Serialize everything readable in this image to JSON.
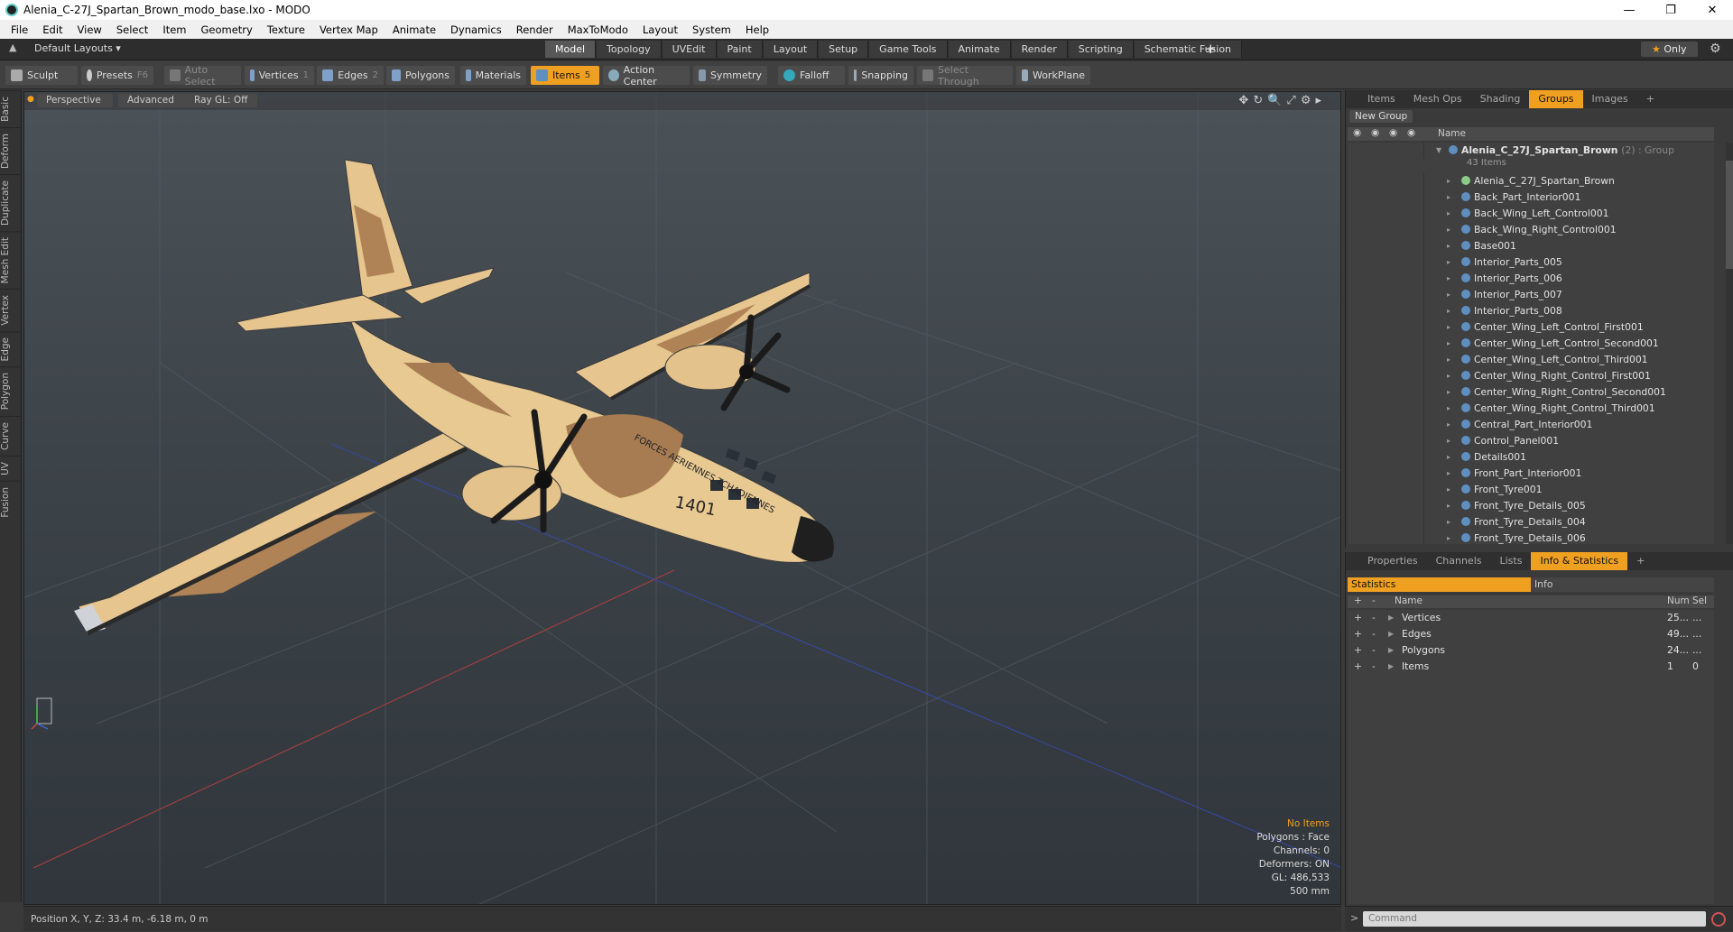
{
  "window": {
    "title": "Alenia_C-27J_Spartan_Brown_modo_base.lxo - MODO"
  },
  "menu": [
    "File",
    "Edit",
    "View",
    "Select",
    "Item",
    "Geometry",
    "Texture",
    "Vertex Map",
    "Animate",
    "Dynamics",
    "Render",
    "MaxToModo",
    "Layout",
    "System",
    "Help"
  ],
  "layouts_label": "Default Layouts ▾",
  "tabs": [
    {
      "label": "Model",
      "active": true
    },
    {
      "label": "Topology"
    },
    {
      "label": "UVEdit"
    },
    {
      "label": "Paint"
    },
    {
      "label": "Layout"
    },
    {
      "label": "Setup"
    },
    {
      "label": "Game Tools"
    },
    {
      "label": "Animate"
    },
    {
      "label": "Render"
    },
    {
      "label": "Scripting"
    },
    {
      "label": "Schematic Fusion"
    }
  ],
  "only_label": "Only",
  "toolbar": {
    "sculpt": "Sculpt",
    "presets": "Presets",
    "presets_key": "F6",
    "auto_select": "Auto Select",
    "vertices": "Vertices",
    "vertices_key": "1",
    "edges": "Edges",
    "edges_key": "2",
    "polygons": "Polygons",
    "materials": "Materials",
    "items": "Items",
    "items_key": "5",
    "action_center": "Action Center",
    "symmetry": "Symmetry",
    "falloff": "Falloff",
    "snapping": "Snapping",
    "select_through": "Select Through",
    "workplane": "WorkPlane"
  },
  "left_tabs": [
    "Basic",
    "Deform",
    "Duplicate",
    "Mesh Edit",
    "Vertex",
    "Edge",
    "Polygon",
    "Curve",
    "UV",
    "Fusion"
  ],
  "viewport": {
    "view": "Perspective",
    "mode": "Advanced",
    "raygl": "Ray GL: Off",
    "hud": {
      "no_items": "No Items",
      "polygons": "Polygons : Face",
      "channels": "Channels: 0",
      "deformers": "Deformers: ON",
      "gl": "GL: 486,533",
      "scale": "500 mm"
    }
  },
  "status": {
    "position": "Position X, Y, Z:  33.4 m, -6.18 m, 0 m"
  },
  "panel_tabs": [
    {
      "label": "Items"
    },
    {
      "label": "Mesh Ops"
    },
    {
      "label": "Shading"
    },
    {
      "label": "Groups",
      "active": true
    },
    {
      "label": "Images"
    }
  ],
  "new_group": "New Group",
  "list_header": "Name",
  "group": {
    "name": "Alenia_C_27J_Spartan_Brown",
    "suffix": "(2) : Group",
    "count": "43 Items"
  },
  "items": [
    "Alenia_C_27J_Spartan_Brown",
    "Back_Part_Interior001",
    "Back_Wing_Left_Control001",
    "Back_Wing_Right_Control001",
    "Base001",
    "Interior_Parts_005",
    "Interior_Parts_006",
    "Interior_Parts_007",
    "Interior_Parts_008",
    "Center_Wing_Left_Control_First001",
    "Center_Wing_Left_Control_Second001",
    "Center_Wing_Left_Control_Third001",
    "Center_Wing_Right_Control_First001",
    "Center_Wing_Right_Control_Second001",
    "Center_Wing_Right_Control_Third001",
    "Central_Part_Interior001",
    "Control_Panel001",
    "Details001",
    "Front_Part_Interior001",
    "Front_Tyre001",
    "Front_Tyre_Details_005",
    "Front_Tyre_Details_004",
    "Front_Tyre_Details_006"
  ],
  "panel2_tabs": [
    {
      "label": "Properties"
    },
    {
      "label": "Channels"
    },
    {
      "label": "Lists"
    },
    {
      "label": "Info & Statistics",
      "active": true
    }
  ],
  "stats_tabs": {
    "statistics": "Statistics",
    "info": "Info"
  },
  "stats_header": {
    "name": "Name",
    "num": "Num",
    "sel": "Sel"
  },
  "stats": [
    {
      "name": "Vertices",
      "num": "25...",
      "sel": "..."
    },
    {
      "name": "Edges",
      "num": "49...",
      "sel": "..."
    },
    {
      "name": "Polygons",
      "num": "24...",
      "sel": "..."
    },
    {
      "name": "Items",
      "num": "1",
      "sel": "0"
    }
  ],
  "command_placeholder": "Command",
  "aircraft": {
    "marking": "FORCES AERIENNES TCHADIENNES",
    "number": "1401"
  }
}
